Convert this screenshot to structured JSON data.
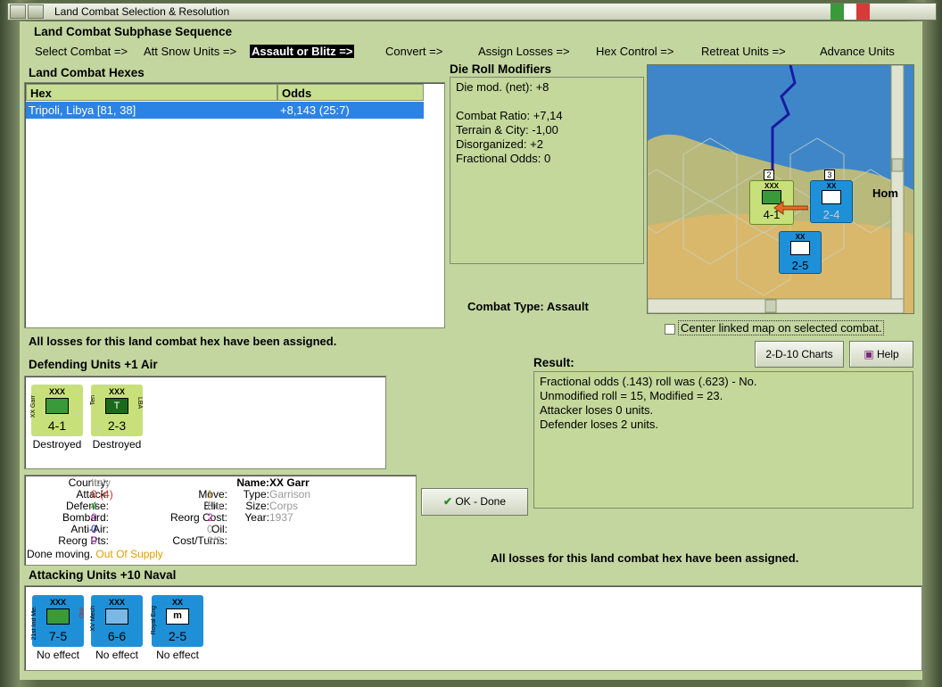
{
  "window": {
    "title": "Land Combat Selection & Resolution",
    "flag_colors": [
      "#3a9a3a",
      "#ffffff",
      "#d83a3a"
    ]
  },
  "sequence": {
    "title": "Land Combat Subphase Sequence",
    "steps": [
      "Select Combat =>",
      "Att Snow Units =>",
      "Assault or Blitz =>",
      "Convert =>",
      "Assign Losses =>",
      "Hex Control =>",
      "Retreat Units =>",
      "Advance Units"
    ]
  },
  "hexes": {
    "title": "Land Combat Hexes",
    "columns": [
      "Hex",
      "Odds"
    ],
    "rows": [
      {
        "hex": "Tripoli, Libya [81, 38]",
        "odds": "+8,143 (25:7)"
      }
    ]
  },
  "modifiers": {
    "title": "Die Roll Modifiers",
    "lines": [
      "Die mod. (net): +8",
      "",
      "Combat Ratio: +7,14",
      "Terrain & City: -1,00",
      "Disorganized: +2",
      "Fractional Odds: 0"
    ]
  },
  "combat_type": "Combat Type:  Assault",
  "map": {
    "label": "Hom",
    "center_linked_label": "Center linked map on selected combat.",
    "units": [
      {
        "size": "XXX",
        "value": "4-1",
        "stack": "2"
      },
      {
        "size": "XX",
        "value": "2-4",
        "stack": "3"
      },
      {
        "size": "XX",
        "value": "2-5"
      }
    ]
  },
  "losses_msg": "All losses for this land combat hex have been assigned.",
  "defending": {
    "title": "Defending Units +1 Air",
    "units": [
      {
        "size": "XXX",
        "name": "XX Garr",
        "value": "4-1",
        "status": "Destroyed",
        "color": "#c8e07a"
      },
      {
        "size": "XXX",
        "name": "Ten",
        "tag": "LBA",
        "symbol": "T",
        "value": "2-3",
        "status": "Destroyed",
        "color": "#c8e07a"
      }
    ]
  },
  "buttons": {
    "charts": "2-D-10 Charts",
    "help": "Help",
    "ok": "OK - Done"
  },
  "result": {
    "title": "Result:",
    "lines": [
      "Fractional odds (.143) roll was (.623)  -  No.",
      "Unmodified roll = 15, Modified = 23.",
      "Attacker loses 0 units.",
      "Defender loses 2 units."
    ]
  },
  "unit_info": {
    "country_label": "Country:",
    "country": "Italy",
    "attack_label": "Attack:",
    "attack": "0",
    "attack_extra": "(4)",
    "defense_label": "Defense:",
    "defense": "4",
    "bombard_label": "Bombard:",
    "bombard": "0",
    "antiair_label": "Anti-Air:",
    "antiair": "0",
    "reorg_pts_label": "Reorg Pts:",
    "reorg_pts": "0",
    "move_label": "Move:",
    "move": "1",
    "elite_label": "Elite:",
    "elite": "No",
    "reorg_cost_label": "Reorg Cost:",
    "reorg_cost": "2",
    "oil_label": "Oil:",
    "oil": "0",
    "cost_turns_label": "Cost/Turns:",
    "cost_turns": "2/2",
    "name_label": "Name:",
    "name": "XX Garr",
    "type_label": "Type:",
    "type": "Garrison",
    "size_label": "Size:",
    "size": "Corps",
    "year_label": "Year:",
    "year": "1937",
    "done_moving": "Done moving.",
    "supply": "Out Of Supply"
  },
  "attacking": {
    "title": "Attacking Units +10 Naval",
    "units": [
      {
        "size": "XXX",
        "name": "21st Ind Me.",
        "tag": "IND",
        "value": "7-5",
        "status": "No effect",
        "color": "#1e90d8"
      },
      {
        "size": "XXX",
        "name": "XV Mech",
        "value": "6-6",
        "status": "No effect",
        "color": "#1e90d8"
      },
      {
        "size": "XX",
        "name": "Royal Eng",
        "symbol": "m",
        "value": "2-5",
        "status": "No effect",
        "color": "#1e90d8"
      }
    ]
  }
}
